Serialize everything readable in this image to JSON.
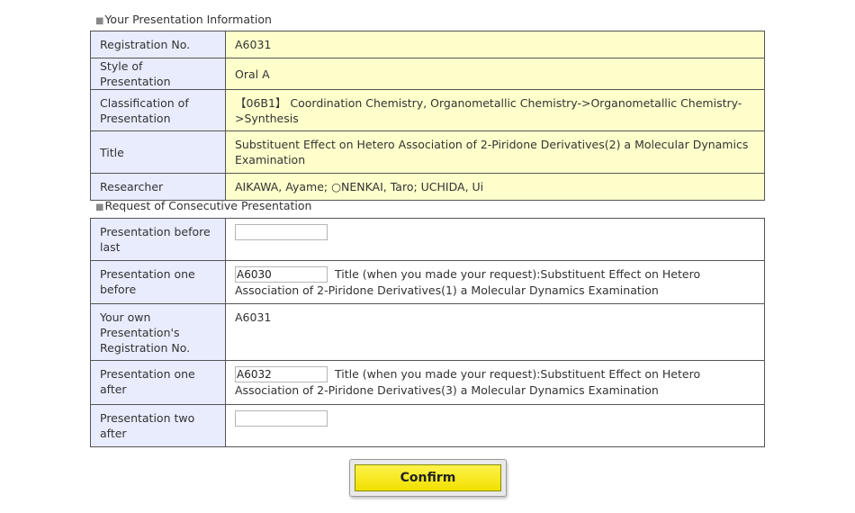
{
  "info_section": {
    "heading": "Your Presentation Information",
    "rows": [
      {
        "label": "Registration No.",
        "value": "A6031"
      },
      {
        "label": "Style of Presentation",
        "value": "Oral A"
      },
      {
        "label": "Classification of Presentation",
        "value": "【06B1】 Coordination Chemistry, Organometallic Chemistry->Organometallic Chemistry->Synthesis"
      },
      {
        "label": "Title",
        "value": "Substituent Effect on Hetero Association of 2-Piridone Derivatives(2) a Molecular Dynamics Examination"
      },
      {
        "label": "Researcher",
        "value": "AIKAWA, Ayame; ○NENKAI, Taro; UCHIDA, Ui"
      }
    ]
  },
  "request_section": {
    "heading": "Request of Consecutive Presentation",
    "rows": [
      {
        "label": "Presentation before last",
        "input_value": ""
      },
      {
        "label": "Presentation one before",
        "input_value": "A6030",
        "note": "Title (when you made your request):Substituent Effect on Hetero Association of 2-Piridone Derivatives(1) a Molecular Dynamics Examination"
      },
      {
        "label": "Your own Presentation's Registration No.",
        "value": "A6031"
      },
      {
        "label": "Presentation one after",
        "input_value": "A6032",
        "note": "Title (when you made your request):Substituent Effect on Hetero Association of 2-Piridone Derivatives(3) a Molecular Dynamics Examination"
      },
      {
        "label": "Presentation two after",
        "input_value": ""
      }
    ]
  },
  "confirm_button": {
    "label": "Confirm"
  },
  "colors": {
    "label_bg": "#e8ecfd",
    "info_value_bg": "#ffffcc",
    "button_yellow": "#fff200",
    "border": "#555555"
  }
}
